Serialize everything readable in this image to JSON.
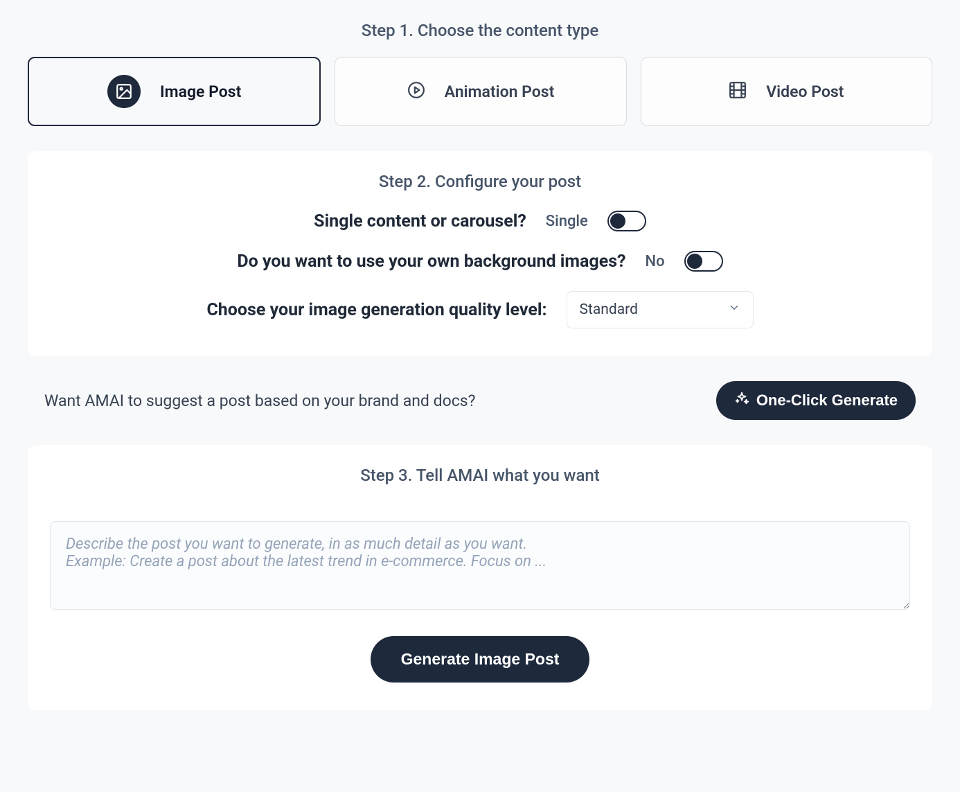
{
  "step1": {
    "title": "Step 1. Choose the content type",
    "types": [
      {
        "label": "Image Post",
        "selected": true
      },
      {
        "label": "Animation Post",
        "selected": false
      },
      {
        "label": "Video Post",
        "selected": false
      }
    ]
  },
  "step2": {
    "title": "Step 2. Configure your post",
    "carousel": {
      "label": "Single content or carousel?",
      "value": "Single",
      "toggle_state": "left"
    },
    "background": {
      "label": "Do you want to use your own background images?",
      "value": "No",
      "toggle_state": "left"
    },
    "quality": {
      "label": "Choose your image generation quality level:",
      "selected": "Standard"
    }
  },
  "suggest": {
    "text": "Want AMAI to suggest a post based on your brand and docs?",
    "button": "One-Click Generate"
  },
  "step3": {
    "title": "Step 3. Tell AMAI what you want",
    "placeholder": "Describe the post you want to generate, in as much detail as you want.\nExample: Create a post about the latest trend in e-commerce. Focus on ...",
    "button": "Generate Image Post"
  }
}
